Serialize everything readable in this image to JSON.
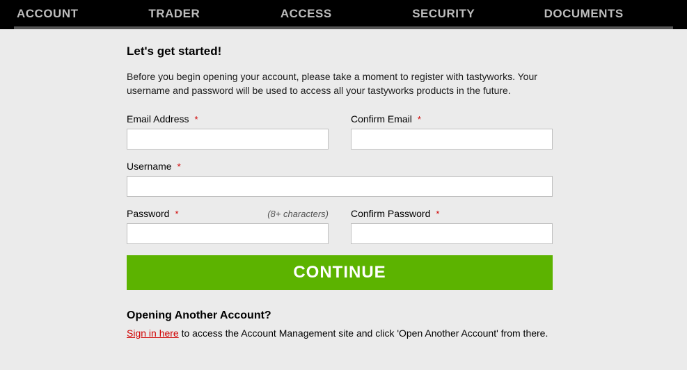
{
  "nav": {
    "tabs": [
      "ACCOUNT",
      "TRADER",
      "ACCESS",
      "SECURITY",
      "DOCUMENTS"
    ]
  },
  "heading": "Let's get started!",
  "intro": "Before you begin opening your account, please take a moment to register with tastyworks. Your username and password will be used to access all your tastyworks products in the future.",
  "form": {
    "email": {
      "label": "Email Address",
      "required": "*"
    },
    "confirm_email": {
      "label": "Confirm Email",
      "required": "*"
    },
    "username": {
      "label": "Username",
      "required": "*"
    },
    "password": {
      "label": "Password",
      "required": "*",
      "hint": "(8+ characters)"
    },
    "confirm_password": {
      "label": "Confirm Password",
      "required": "*"
    },
    "continue": "CONTINUE"
  },
  "another": {
    "heading": "Opening Another Account?",
    "link": "Sign in here",
    "rest": " to access the Account Management site and click 'Open Another Account' from there."
  }
}
